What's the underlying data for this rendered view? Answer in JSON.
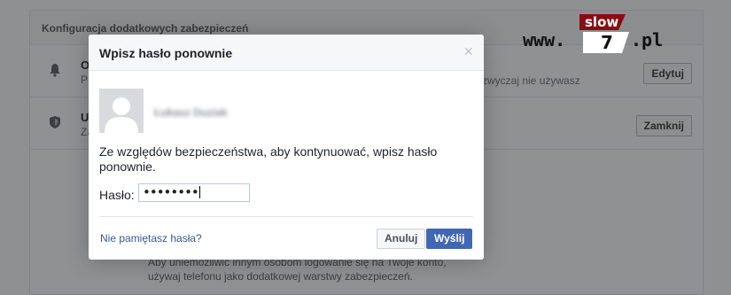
{
  "background": {
    "section_title": "Konfiguracja dodatkowych zabezpieczeń",
    "rows": [
      {
        "title_fragment": "O",
        "subtitle_fragment": "P",
        "right_text": "zwyczaj nie używasz",
        "button": "Edytuj",
        "icon": "bell-icon"
      },
      {
        "title_fragment": "U",
        "subtitle_fragment": "Za",
        "right_text": "",
        "button": "Zamknij",
        "icon": "shield-icon"
      }
    ],
    "bottom_text": [
      "Aby uniemożliwić innym osobom logowanie się na Twoje konto,",
      "używaj telefonu jako dodatkowej warstwy zabezpieczeń."
    ]
  },
  "watermark": {
    "prefix": "www.",
    "word": "slow",
    "digit": "7",
    "suffix": ".pl"
  },
  "dialog": {
    "title": "Wpisz hasło ponownie",
    "close_icon": "×",
    "user_name": "Łukasz Duziak",
    "message": "Ze względów bezpieczeństwa, aby kontynuować, wpisz hasło ponownie.",
    "password_label": "Hasło:",
    "password_value": "••••••••",
    "forgot_link": "Nie pamiętasz hasła?",
    "cancel_button": "Anuluj",
    "submit_button": "Wyślij"
  },
  "colors": {
    "overlay": "#8f9092",
    "primary": "#4267b2",
    "link": "#365899"
  }
}
